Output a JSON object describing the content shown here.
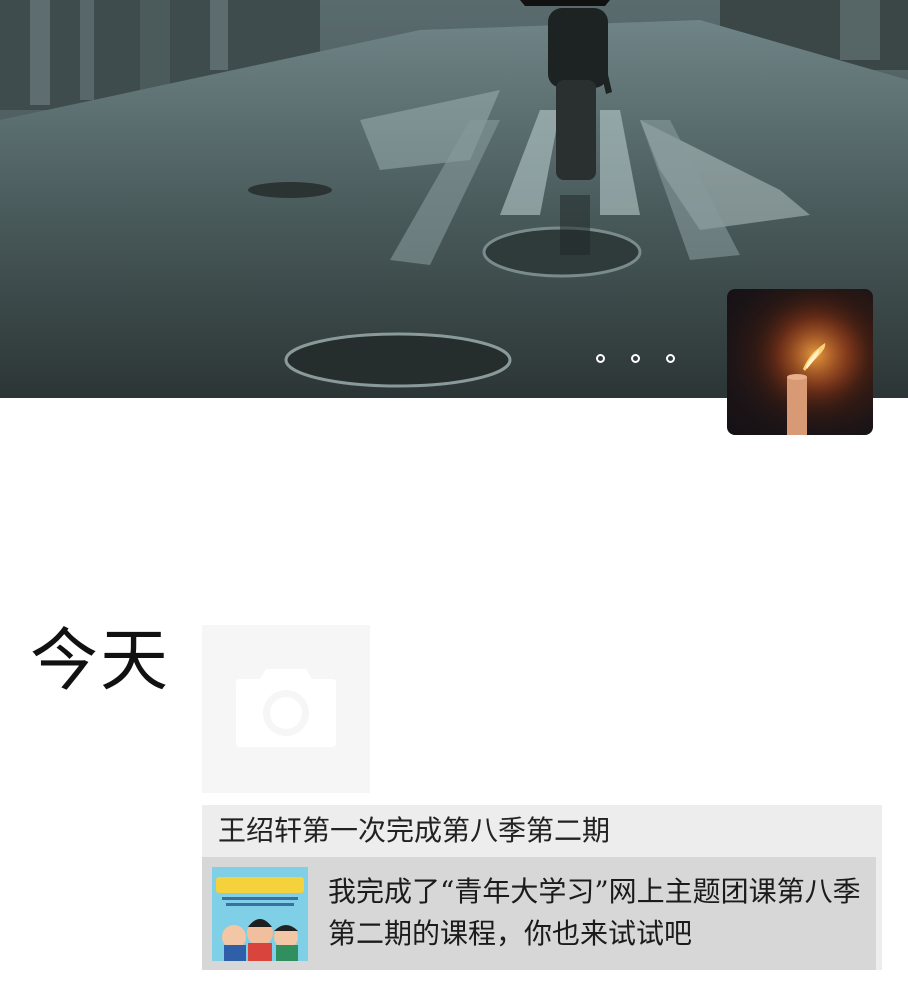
{
  "cover": {
    "image": "rainy-street-person-with-umbrella",
    "carousel_dots": 3
  },
  "avatar": {
    "image": "candle-flame"
  },
  "feed": {
    "date_label": "今天",
    "photo_post": {
      "placeholder_icon": "camera-icon"
    },
    "share_post": {
      "text": "王绍轩第一次完成第八季第二期",
      "link": {
        "title": "我完成了“青年大学习”网上主题团课第八季第二期的课程，你也来试试吧",
        "thumbnail_text": "青年大学习"
      }
    }
  }
}
